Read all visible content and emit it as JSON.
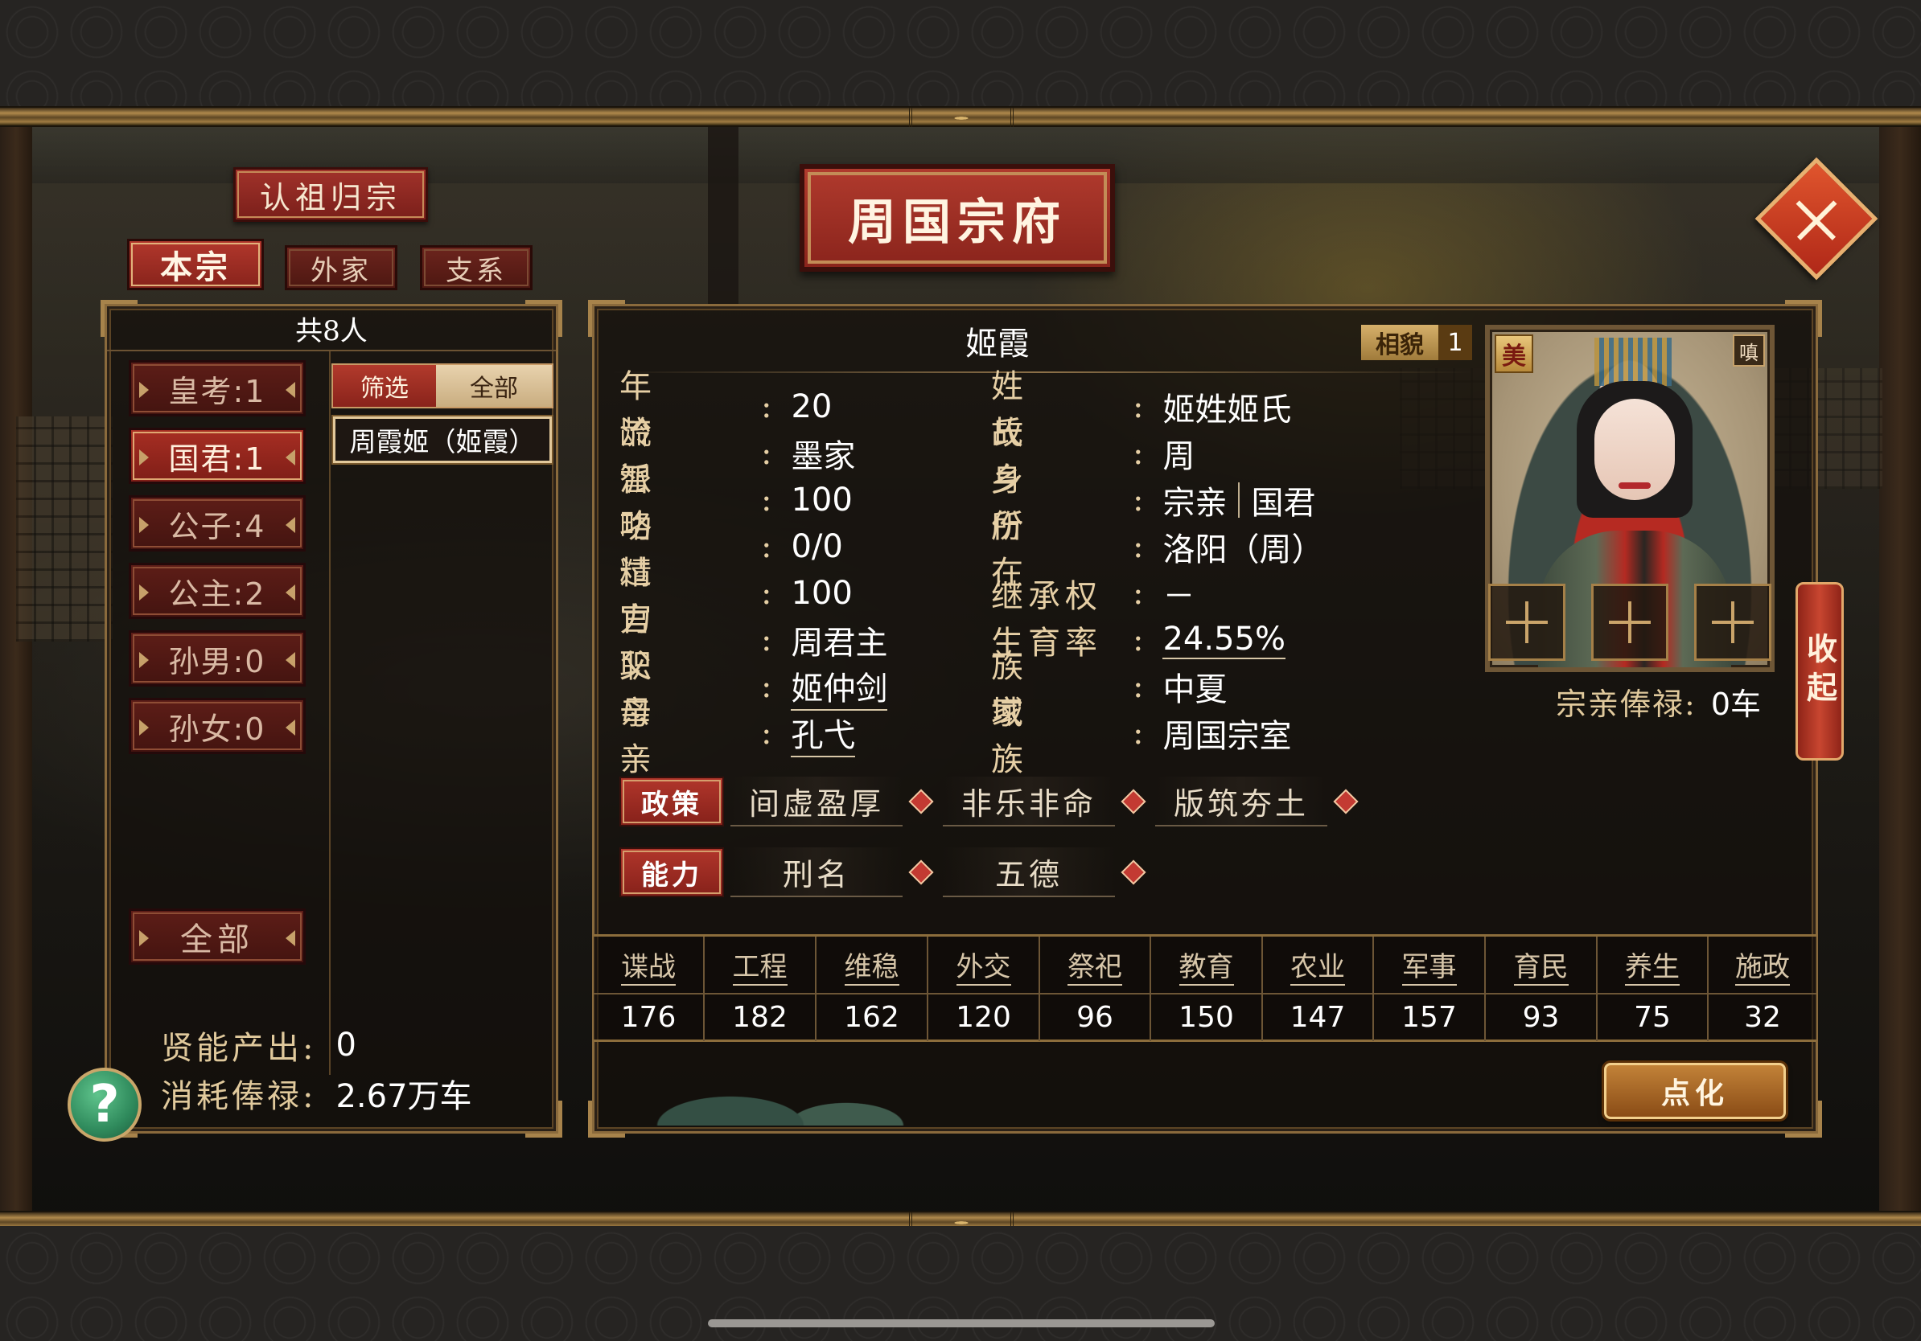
{
  "left": {
    "recognize_button": "认祖归宗",
    "tabs": [
      {
        "label": "本宗",
        "active": true
      },
      {
        "label": "外家",
        "active": false
      },
      {
        "label": "支系",
        "active": false
      }
    ],
    "count_title": "共8人",
    "categories": [
      {
        "label": "皇考:1",
        "active": false
      },
      {
        "label": "国君:1",
        "active": true
      },
      {
        "label": "公子:4",
        "active": false
      },
      {
        "label": "公主:2",
        "active": false
      },
      {
        "label": "孙男:0",
        "active": false
      },
      {
        "label": "孙女:0",
        "active": false
      }
    ],
    "all_button": "全部",
    "filter": {
      "filter_label": "筛选",
      "all_label": "全部"
    },
    "member": "周霞姬（姬霞）",
    "output_label": "贤能产出:",
    "output_value": "0",
    "consume_label": "消耗俸禄:",
    "consume_value": "2.67万车"
  },
  "header": {
    "title": "周国宗府"
  },
  "detail": {
    "name": "姬霞",
    "appearance_label": "相貌",
    "appearance_value": "1",
    "portrait_badge_left": "美",
    "portrait_badge_right": "嗔",
    "collapse_label": "收起",
    "salary_label": "宗亲俸禄:",
    "salary_value": "0车",
    "left_rows": [
      {
        "label": "年龄",
        "value": "20"
      },
      {
        "label": "流派",
        "value": "墨家"
      },
      {
        "label": "智略",
        "value": "100"
      },
      {
        "label": "功过",
        "value": "0/0"
      },
      {
        "label": "精力",
        "value": "100"
      },
      {
        "label": "官职",
        "value": "周君主"
      },
      {
        "label": "父亲",
        "value": "姬仲剑"
      },
      {
        "label": "母亲",
        "value": "孔弋"
      }
    ],
    "right_rows": [
      {
        "label": "姓氏",
        "value": "姬姓姬氏"
      },
      {
        "label": "故乡",
        "value": "周"
      },
      {
        "label": "身份",
        "value": "宗亲",
        "value2": "国君"
      },
      {
        "label": "所在",
        "value": "洛阳（周）"
      },
      {
        "label": "继承权",
        "value": "－"
      },
      {
        "label": "生育率",
        "value": "24.55%"
      },
      {
        "label": "族域",
        "value": "中夏"
      },
      {
        "label": "家族",
        "value": "周国宗室"
      }
    ],
    "policy_label": "政策",
    "policies": [
      "间虚盈厚",
      "非乐非命",
      "版筑夯土"
    ],
    "ability_label": "能力",
    "abilities": [
      "刑名",
      "五德"
    ],
    "stats": {
      "headers": [
        "谍战",
        "工程",
        "维稳",
        "外交",
        "祭祀",
        "教育",
        "农业",
        "军事",
        "育民",
        "养生",
        "施政"
      ],
      "values": [
        "176",
        "182",
        "162",
        "120",
        "96",
        "150",
        "147",
        "157",
        "93",
        "75",
        "32"
      ]
    },
    "enlighten_button": "点化"
  },
  "icons": {
    "close": "close-icon",
    "help": "help-icon",
    "plus": "plus-icon"
  },
  "colors": {
    "accent_red": "#a1322a",
    "gold": "#a7834b",
    "help_green": "#2f8a5c"
  }
}
